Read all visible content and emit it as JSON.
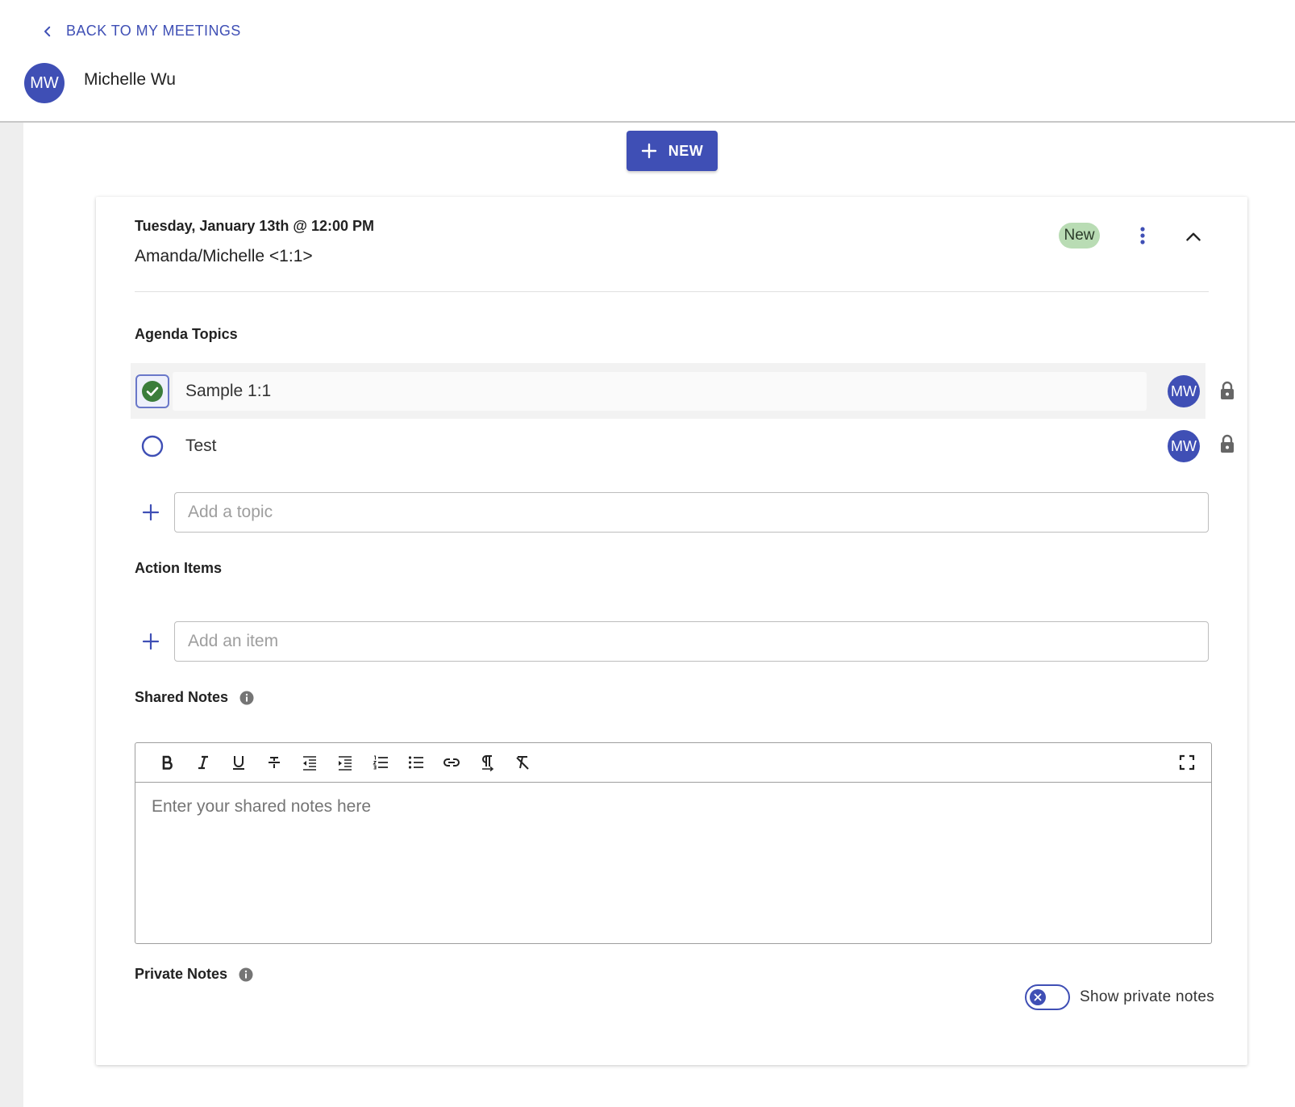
{
  "header": {
    "back_label": "BACK TO MY MEETINGS",
    "user_initials": "MW",
    "user_name": "Michelle Wu"
  },
  "toolbar": {
    "new_label": "NEW"
  },
  "meeting": {
    "date": "Tuesday, January 13th @ 12:00 PM",
    "title": "Amanda/Michelle <1:1>",
    "status": "New"
  },
  "agenda": {
    "title": "Agenda Topics",
    "topics": [
      {
        "label": "Sample 1:1",
        "done": true,
        "owner": "MW",
        "locked": true
      },
      {
        "label": "Test",
        "done": false,
        "owner": "MW",
        "locked": true
      }
    ],
    "add_placeholder": "Add a topic"
  },
  "actions": {
    "title": "Action Items",
    "add_placeholder": "Add an item"
  },
  "shared_notes": {
    "title": "Shared Notes",
    "placeholder": "Enter your shared notes here",
    "tools": [
      "bold",
      "italic",
      "underline",
      "strikethrough",
      "outdent",
      "indent",
      "ordered-list",
      "bullet-list",
      "link",
      "paragraph",
      "clear-format"
    ]
  },
  "private_notes": {
    "title": "Private Notes",
    "toggle_label": "Show private notes",
    "toggle_on": false
  },
  "colors": {
    "primary": "#3f4fb5",
    "badge_bg": "#b9dcb4",
    "check_green": "#3b7d3b"
  }
}
